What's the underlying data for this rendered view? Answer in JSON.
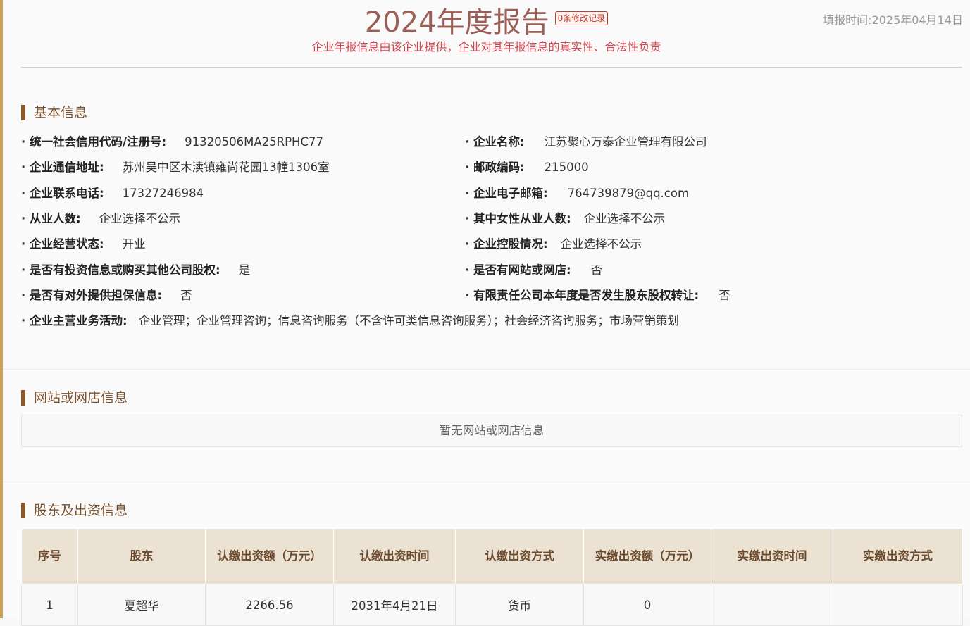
{
  "header": {
    "title": "2024年度报告",
    "modify_badge": "0条修改记录",
    "subtitle": "企业年报信息由该企业提供，企业对其年报信息的真实性、合法性负责",
    "fill_time": "填报时间:2025年04月14日"
  },
  "basic_info": {
    "section_title": "基本信息",
    "bullet": "·",
    "fields": [
      {
        "label": "统一社会信用代码/注册号:",
        "value": "91320506MA25RPHC77"
      },
      {
        "label": "企业名称:",
        "value": "江苏聚心万泰企业管理有限公司"
      },
      {
        "label": "企业通信地址:",
        "value": "苏州吴中区木渎镇雍尚花园13幢1306室"
      },
      {
        "label": "邮政编码:",
        "value": "215000"
      },
      {
        "label": "企业联系电话:",
        "value": "17327246984"
      },
      {
        "label": "企业电子邮箱:",
        "value": "764739879@qq.com"
      },
      {
        "label": "从业人数:",
        "value": "企业选择不公示"
      },
      {
        "label": "其中女性从业人数:",
        "value": "企业选择不公示"
      },
      {
        "label": "企业经营状态:",
        "value": "开业"
      },
      {
        "label": "企业控股情况:",
        "value": "企业选择不公示"
      },
      {
        "label": "是否有投资信息或购买其他公司股权:",
        "value": "是"
      },
      {
        "label": "是否有网站或网店:",
        "value": "否"
      },
      {
        "label": "是否有对外提供担保信息:",
        "value": "否"
      },
      {
        "label": "有限责任公司本年度是否发生股东股权转让:",
        "value": "否"
      },
      {
        "label": "企业主营业务活动:",
        "value": "企业管理；企业管理咨询；信息咨询服务（不含许可类信息咨询服务）；社会经济咨询服务；市场营销策划"
      }
    ]
  },
  "website_info": {
    "section_title": "网站或网店信息",
    "empty_text": "暂无网站或网店信息"
  },
  "shareholder_info": {
    "section_title": "股东及出资信息",
    "columns": [
      "序号",
      "股东",
      "认缴出资额（万元）",
      "认缴出资时间",
      "认缴出资方式",
      "实缴出资额（万元）",
      "实缴出资时间",
      "实缴出资方式"
    ],
    "rows": [
      [
        "1",
        "夏超华",
        "2266.56",
        "2031年4月21日",
        "货币",
        "0",
        "",
        ""
      ]
    ]
  },
  "colors": {
    "title": "#9a5e56",
    "subtitle": "#d0454c",
    "section_accent": "#8b5a2b",
    "table_header_bg": "#ebe2d4",
    "left_bar": "#c9a35a"
  }
}
